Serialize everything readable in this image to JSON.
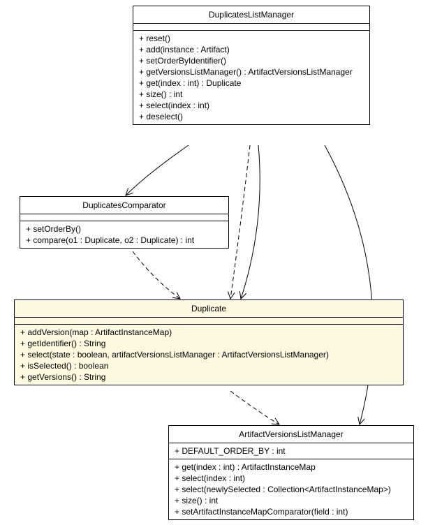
{
  "classes": {
    "duplicatesListManager": {
      "title": "DuplicatesListManager",
      "methods": [
        "+ reset()",
        "+ add(instance : Artifact)",
        "+ setOrderByIdentifier()",
        "+ getVersionsListManager() : ArtifactVersionsListManager",
        "+ get(index : int) : Duplicate",
        "+ size() : int",
        "+ select(index : int)",
        "+ deselect()"
      ]
    },
    "duplicatesComparator": {
      "title": "DuplicatesComparator",
      "methods": [
        "+ setOrderBy()",
        "+ compare(o1 : Duplicate, o2 : Duplicate) : int"
      ]
    },
    "duplicate": {
      "title": "Duplicate",
      "methods": [
        "+ addVersion(map : ArtifactInstanceMap)",
        "+ getIdentifier() : String",
        "+ select(state : boolean, artifactVersionsListManager : ArtifactVersionsListManager)",
        "+ isSelected() : boolean",
        "+ getVersions() : String"
      ]
    },
    "artifactVersionsListManager": {
      "title": "ArtifactVersionsListManager",
      "attributes": [
        "+ DEFAULT_ORDER_BY : int"
      ],
      "methods": [
        "+ get(index : int) : ArtifactInstanceMap",
        "+ select(index : int)",
        "+ select(newlySelected : Collection<ArtifactInstanceMap>)",
        "+ size() : int",
        "+ setArtifactInstanceMapComparator(field : int)"
      ]
    }
  },
  "chart_data": {
    "type": "table",
    "title": "UML Class Diagram",
    "nodes": [
      {
        "id": "DuplicatesListManager",
        "kind": "class"
      },
      {
        "id": "DuplicatesComparator",
        "kind": "class"
      },
      {
        "id": "Duplicate",
        "kind": "class",
        "highlighted": true
      },
      {
        "id": "ArtifactVersionsListManager",
        "kind": "class"
      }
    ],
    "edges": [
      {
        "from": "DuplicatesListManager",
        "to": "DuplicatesComparator",
        "style": "solid-arrow"
      },
      {
        "from": "DuplicatesListManager",
        "to": "Duplicate",
        "style": "solid-arrow"
      },
      {
        "from": "DuplicatesListManager",
        "to": "Duplicate",
        "style": "dashed-arrow"
      },
      {
        "from": "DuplicatesListManager",
        "to": "ArtifactVersionsListManager",
        "style": "solid-arrow"
      },
      {
        "from": "DuplicatesComparator",
        "to": "Duplicate",
        "style": "dashed-arrow"
      },
      {
        "from": "Duplicate",
        "to": "ArtifactVersionsListManager",
        "style": "dashed-arrow"
      }
    ]
  }
}
